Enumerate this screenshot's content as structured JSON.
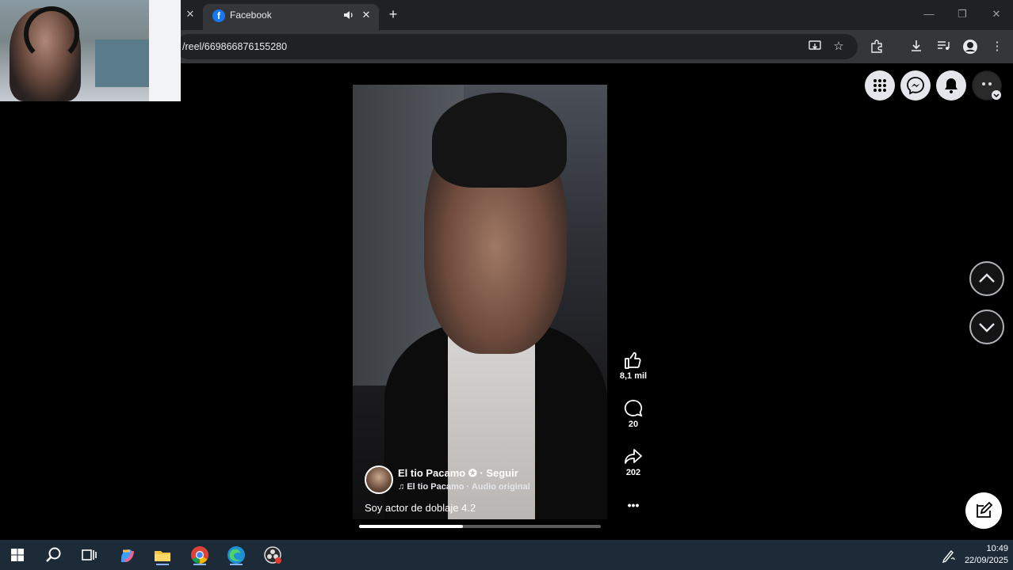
{
  "browser": {
    "tab_title": "Facebook",
    "url": "/reel/669866876155280"
  },
  "reel": {
    "author_name": "El tio Pacamo",
    "follow_label": "· Seguir",
    "audio_label": "El tio Pacamo · Audio original",
    "caption": "Soy actor de doblaje 4.2",
    "progress_fraction": 0.43,
    "likes": "8,1 mil",
    "comments": "20",
    "shares": "202",
    "more": "•••"
  },
  "taskbar": {
    "time": "10:49",
    "date": "22/09/2025"
  },
  "colors": {
    "fb_blue": "#1877f2",
    "chrome_dark": "#202124",
    "taskbar": "#1c2b37"
  }
}
